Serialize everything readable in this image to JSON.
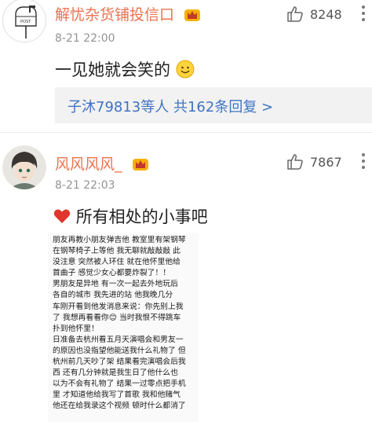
{
  "comments": [
    {
      "username": "解忧杂货铺投信口",
      "time": "8-21 22:00",
      "likes": "8248",
      "text": "一见她就会笑的",
      "avatar_label": "POST",
      "replies_summary": "子沐79813等人 共162条回复 >"
    },
    {
      "username": "风风风风_",
      "time": "8-21 22:03",
      "likes": "7867",
      "text": "所有相处的小事吧"
    }
  ],
  "quote_image_lines": [
    "朋友再教小朋友弹吉他  教室里有架钢琴",
    "在钢琴椅子上等他  我无聊就敲敲敲  此",
    "没注意  突然被人环住  就在他怀里他给",
    "首曲子  感觉少女心都要炸裂了！！",
    "男朋友是异地  有一次一起去外地玩后",
    "各自的城市  我先进的站  他我晚几分",
    "车刚开看到他发消息来说：你先别上我",
    "了  我想再看看你😊  当时我恨不得跳车",
    "扑到他怀里！",
    "日准备去杭州看五月天演唱会和男友一",
    "的原因也没指望他能送我什么礼物了  但",
    "杭州前几天吵了架  结果看完演唱会后我",
    "西  还有几分钟就是我生日了他什么也",
    "以为不会有礼物了  结果一过零点把手机",
    "里  才知道他给我写了首歌  我和他赌气",
    "他还在给我录这个视频  顿时什么都消了"
  ]
}
